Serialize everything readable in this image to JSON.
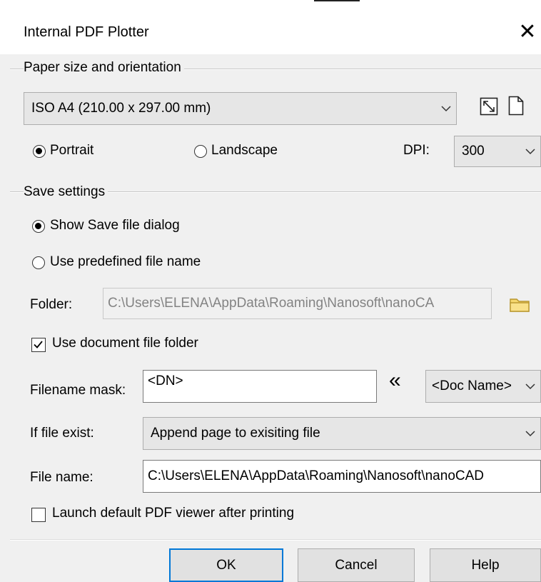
{
  "dialog": {
    "title": "Internal PDF Plotter",
    "close_glyph": "✕"
  },
  "paper": {
    "group_label": "Paper size and orientation",
    "size_value": "ISO A4 (210.00 x 297.00 mm)",
    "orientation_options": [
      "Portrait",
      "Landscape"
    ],
    "orientation_selected": "Portrait",
    "portrait_label": "Portrait",
    "landscape_label": "Landscape",
    "dpi_label": "DPI:",
    "dpi_value": "300",
    "icons": [
      "fit-to-page-icon",
      "page-orientation-icon"
    ]
  },
  "save": {
    "group_label": "Save settings",
    "show_dialog_label": "Show Save file dialog",
    "predefined_label": "Use predefined file name",
    "selected_mode": "Show Save file dialog",
    "folder_label": "Folder:",
    "folder_value": "C:\\Users\\ELENA\\AppData\\Roaming\\Nanosoft\\nanoCA",
    "use_doc_folder_label": "Use document file folder",
    "use_doc_folder_checked": true,
    "mask_label": "Filename mask:",
    "mask_value": "<DN>",
    "insert_glyph": "«",
    "mask_token_value": "<Doc Name>",
    "exist_label": "If file exist:",
    "exist_value": "Append page to exisiting file",
    "filename_label": "File name:",
    "filename_value": "C:\\Users\\ELENA\\AppData\\Roaming\\Nanosoft\\nanoCAD",
    "launch_label": "Launch default PDF viewer after printing",
    "launch_checked": false
  },
  "buttons": {
    "ok": "OK",
    "cancel": "Cancel",
    "help": "Help"
  },
  "colors": {
    "accent": "#0078d7",
    "folder_icon": "#f5d76e"
  }
}
